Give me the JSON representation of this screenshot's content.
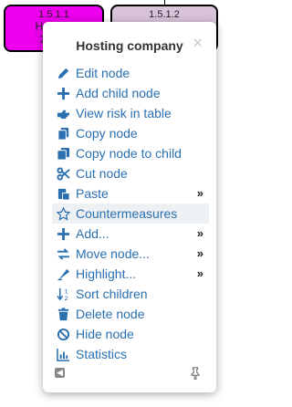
{
  "tree": {
    "node_a": {
      "id": "1.5.1.1",
      "label": "Hosting",
      "sub": "2 / 4 /"
    },
    "node_b": {
      "id": "1.5.1.2",
      "label": "",
      "sub": ""
    }
  },
  "menu": {
    "title": "Hosting company",
    "close_glyph": "×",
    "items": [
      {
        "label": "Edit node",
        "icon": "pencil-icon",
        "submenu": false
      },
      {
        "label": "Add child node",
        "icon": "plus-icon",
        "submenu": false
      },
      {
        "label": "View risk in table",
        "icon": "hand-pointer-icon",
        "submenu": false
      },
      {
        "label": "Copy node",
        "icon": "copy-icon",
        "submenu": false
      },
      {
        "label": "Copy node to child",
        "icon": "copy-child-icon",
        "submenu": false
      },
      {
        "label": "Cut node",
        "icon": "scissors-icon",
        "submenu": false
      },
      {
        "label": "Paste",
        "icon": "paste-icon",
        "submenu": true
      },
      {
        "label": "Countermeasures",
        "icon": "star-icon",
        "submenu": false,
        "active": true
      },
      {
        "label": "Add...",
        "icon": "plus-icon",
        "submenu": true
      },
      {
        "label": "Move node...",
        "icon": "swap-arrows-icon",
        "submenu": true
      },
      {
        "label": "Highlight...",
        "icon": "highlighter-icon",
        "submenu": true
      },
      {
        "label": "Sort children",
        "icon": "sort-numeric-icon",
        "submenu": false
      },
      {
        "label": "Delete node",
        "icon": "trash-icon",
        "submenu": false
      },
      {
        "label": "Hide node",
        "icon": "ban-icon",
        "submenu": false
      },
      {
        "label": "Statistics",
        "icon": "bar-chart-icon",
        "submenu": false
      }
    ],
    "submenu_glyph": "»",
    "collapse_glyph": "◀"
  },
  "colors": {
    "accent": "#2a6fb0",
    "node_a_bg": "#ee00ee",
    "node_b_bg": "#d9c3d9"
  }
}
